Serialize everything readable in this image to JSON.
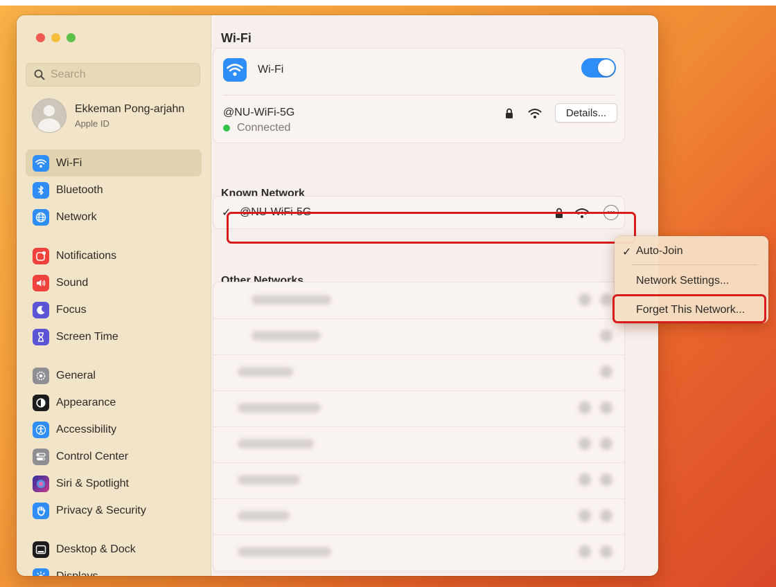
{
  "sidebar": {
    "search_placeholder": "Search",
    "profile": {
      "name": "Ekkeman Pong-arjahn",
      "subtitle": "Apple ID"
    },
    "items": [
      {
        "label": "Wi-Fi",
        "icon": "wifi-icon",
        "color": "#2f8df7",
        "active": true
      },
      {
        "label": "Bluetooth",
        "icon": "bluetooth-icon",
        "color": "#2f8df7"
      },
      {
        "label": "Network",
        "icon": "globe-icon",
        "color": "#2f8df7"
      },
      {
        "label": "Notifications",
        "icon": "bell-icon",
        "color": "#f0413c"
      },
      {
        "label": "Sound",
        "icon": "speaker-icon",
        "color": "#f0413c"
      },
      {
        "label": "Focus",
        "icon": "moon-icon",
        "color": "#5b55d6"
      },
      {
        "label": "Screen Time",
        "icon": "hourglass-icon",
        "color": "#5b55d6"
      },
      {
        "label": "General",
        "icon": "gear-icon",
        "color": "#8e8e93"
      },
      {
        "label": "Appearance",
        "icon": "appearance-icon",
        "color": "#1c1c1e"
      },
      {
        "label": "Accessibility",
        "icon": "accessibility-icon",
        "color": "#2f8df7"
      },
      {
        "label": "Control Center",
        "icon": "control-center-icon",
        "color": "#8e8e93"
      },
      {
        "label": "Siri & Spotlight",
        "icon": "siri-icon",
        "color": "#7a3fd1"
      },
      {
        "label": "Privacy & Security",
        "icon": "hand-icon",
        "color": "#2f8df7"
      },
      {
        "label": "Desktop & Dock",
        "icon": "dock-icon",
        "color": "#1c1c1e"
      },
      {
        "label": "Displays",
        "icon": "sun-icon",
        "color": "#2f8df7"
      }
    ]
  },
  "main": {
    "title": "Wi-Fi",
    "wifi_label": "Wi-Fi",
    "wifi_enabled": true,
    "current_network": "@NU-WiFi-5G",
    "current_status": "Connected",
    "details_label": "Details...",
    "known_header": "Known Network",
    "known_network": "@NU-WiFi-5G",
    "other_header": "Other Networks"
  },
  "context_menu": {
    "items": [
      {
        "label": "Auto-Join",
        "checked": true
      },
      {
        "label": "Network Settings..."
      },
      {
        "label": "Forget This Network..."
      }
    ]
  },
  "colors": {
    "accent": "#2f8df7",
    "highlight": "#d81b1b",
    "connected": "#33c24a"
  }
}
